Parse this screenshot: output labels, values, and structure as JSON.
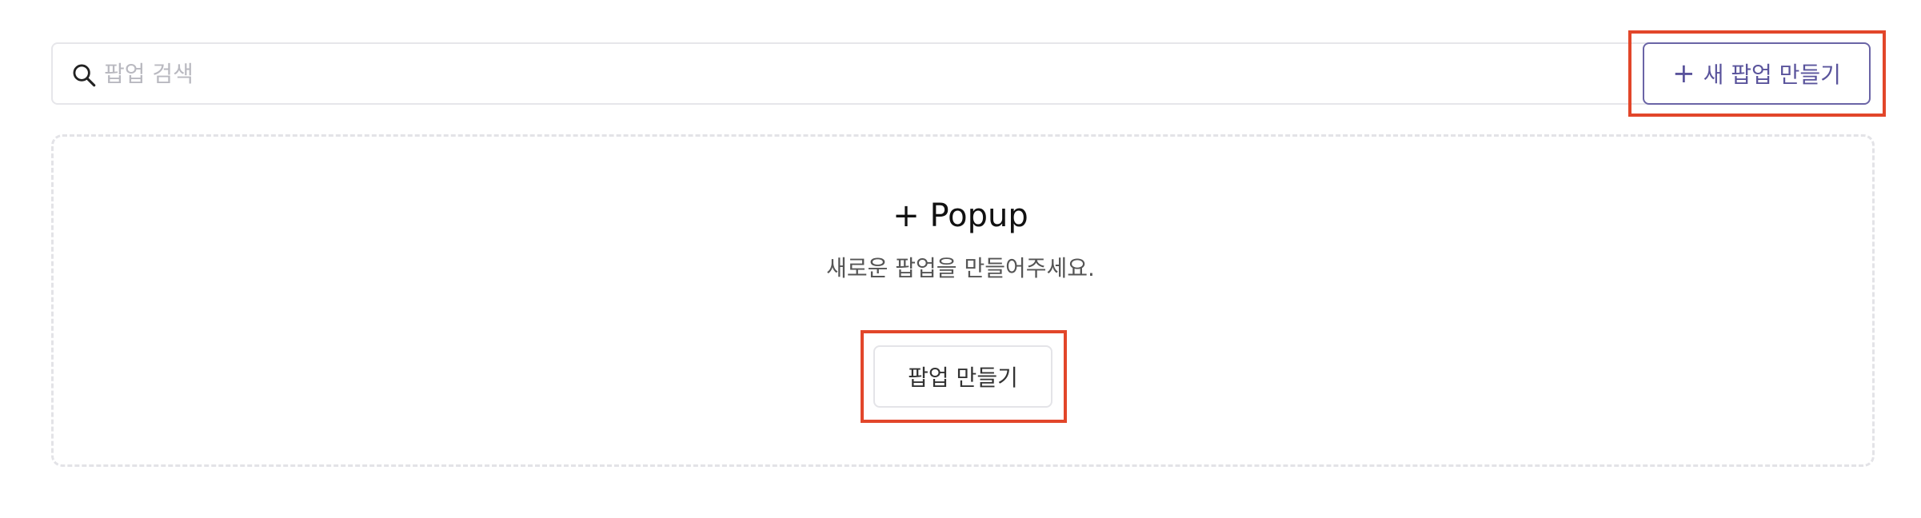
{
  "search": {
    "placeholder": "팝업 검색",
    "value": "",
    "icon": "search-icon"
  },
  "toolbar": {
    "new_button_plus": "+",
    "new_button_label": "새 팝업 만들기"
  },
  "empty_state": {
    "title": "+ Popup",
    "description": "새로운 팝업을 만들어주세요.",
    "create_button_label": "팝업 만들기"
  },
  "colors": {
    "accent": "#5a549c",
    "highlight": "#e2462a",
    "border": "#e6e6ea"
  }
}
